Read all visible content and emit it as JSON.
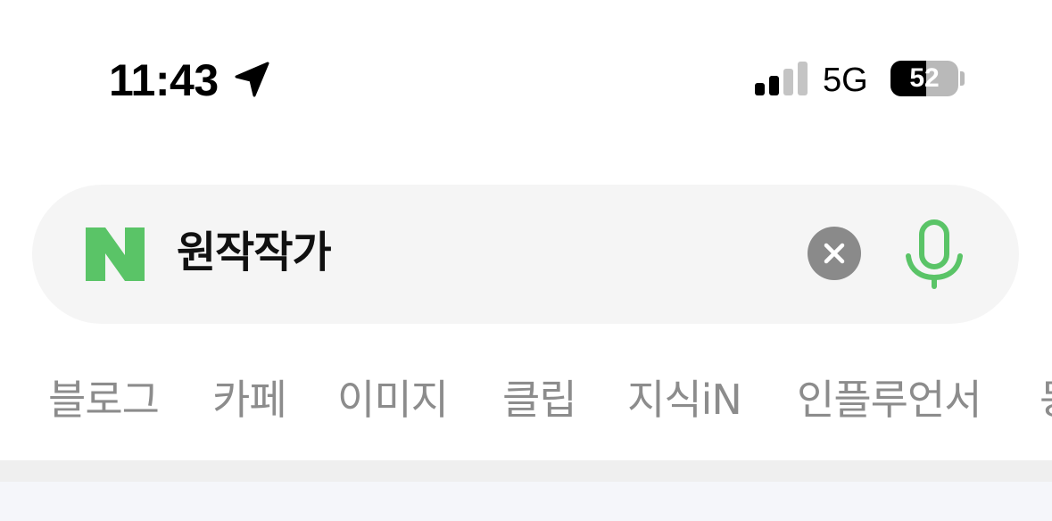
{
  "status_bar": {
    "time": "11:43",
    "network": "5G",
    "battery_level": "52",
    "battery_fraction": 0.52,
    "signal_bars_active": 2,
    "signal_bars_total": 4,
    "icons": [
      "location-arrow-icon",
      "cellular-signal-icon",
      "battery-icon"
    ]
  },
  "search": {
    "logo": "N",
    "query": "원작작가",
    "clear_icon": "close-icon",
    "voice_icon": "microphone-icon"
  },
  "tabs": [
    {
      "label": "블로그"
    },
    {
      "label": "카페"
    },
    {
      "label": "이미지"
    },
    {
      "label": "클립"
    },
    {
      "label": "지식iN"
    },
    {
      "label": "인플루언서"
    },
    {
      "label": "동"
    }
  ],
  "colors": {
    "naver_green": "#5ac467",
    "tab_text": "#8c8c8c",
    "search_bg": "#f5f5f5",
    "clear_button_bg": "#8a8a8a"
  }
}
